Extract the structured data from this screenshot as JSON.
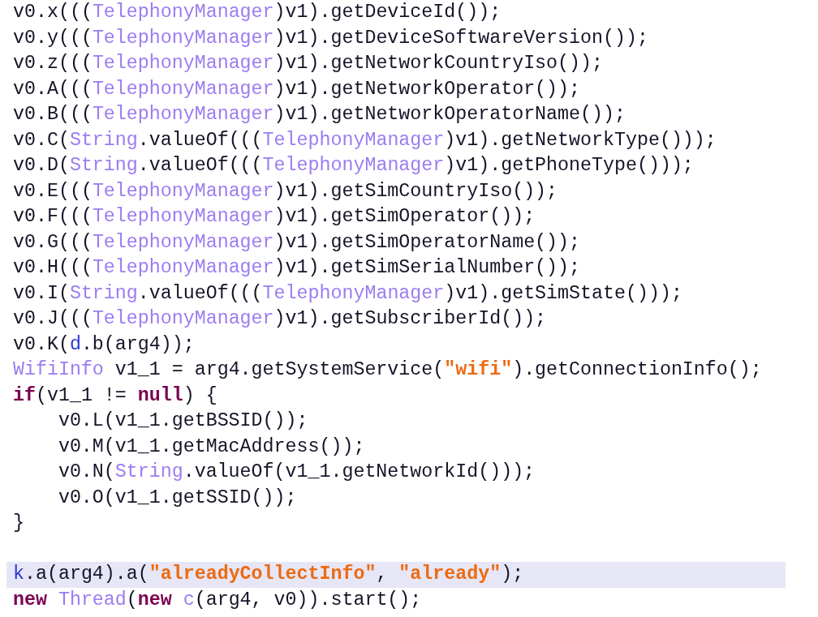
{
  "code_groups": [
    {
      "lines": [
        {
          "selected": false,
          "tokens": [
            {
              "kind": "plain",
              "text": "v0.x((("
            },
            {
              "kind": "type",
              "text": "TelephonyManager"
            },
            {
              "kind": "plain",
              "text": ")v1).getDeviceId());"
            }
          ]
        },
        {
          "selected": false,
          "tokens": [
            {
              "kind": "plain",
              "text": "v0.y((("
            },
            {
              "kind": "type",
              "text": "TelephonyManager"
            },
            {
              "kind": "plain",
              "text": ")v1).getDeviceSoftwareVersion());"
            }
          ]
        },
        {
          "selected": false,
          "tokens": [
            {
              "kind": "plain",
              "text": "v0.z((("
            },
            {
              "kind": "type",
              "text": "TelephonyManager"
            },
            {
              "kind": "plain",
              "text": ")v1).getNetworkCountryIso());"
            }
          ]
        },
        {
          "selected": false,
          "tokens": [
            {
              "kind": "plain",
              "text": "v0.A((("
            },
            {
              "kind": "type",
              "text": "TelephonyManager"
            },
            {
              "kind": "plain",
              "text": ")v1).getNetworkOperator());"
            }
          ]
        },
        {
          "selected": false,
          "tokens": [
            {
              "kind": "plain",
              "text": "v0.B((("
            },
            {
              "kind": "type",
              "text": "TelephonyManager"
            },
            {
              "kind": "plain",
              "text": ")v1).getNetworkOperatorName());"
            }
          ]
        },
        {
          "selected": false,
          "tokens": [
            {
              "kind": "plain",
              "text": "v0.C("
            },
            {
              "kind": "type",
              "text": "String"
            },
            {
              "kind": "plain",
              "text": ".valueOf((("
            },
            {
              "kind": "type",
              "text": "TelephonyManager"
            },
            {
              "kind": "plain",
              "text": ")v1).getNetworkType()));"
            }
          ]
        },
        {
          "selected": false,
          "tokens": [
            {
              "kind": "plain",
              "text": "v0.D("
            },
            {
              "kind": "type",
              "text": "String"
            },
            {
              "kind": "plain",
              "text": ".valueOf((("
            },
            {
              "kind": "type",
              "text": "TelephonyManager"
            },
            {
              "kind": "plain",
              "text": ")v1).getPhoneType()));"
            }
          ]
        },
        {
          "selected": false,
          "tokens": [
            {
              "kind": "plain",
              "text": "v0.E((("
            },
            {
              "kind": "type",
              "text": "TelephonyManager"
            },
            {
              "kind": "plain",
              "text": ")v1).getSimCountryIso());"
            }
          ]
        },
        {
          "selected": false,
          "tokens": [
            {
              "kind": "plain",
              "text": "v0.F((("
            },
            {
              "kind": "type",
              "text": "TelephonyManager"
            },
            {
              "kind": "plain",
              "text": ")v1).getSimOperator());"
            }
          ]
        },
        {
          "selected": false,
          "tokens": [
            {
              "kind": "plain",
              "text": "v0.G((("
            },
            {
              "kind": "type",
              "text": "TelephonyManager"
            },
            {
              "kind": "plain",
              "text": ")v1).getSimOperatorName());"
            }
          ]
        },
        {
          "selected": false,
          "tokens": [
            {
              "kind": "plain",
              "text": "v0.H((("
            },
            {
              "kind": "type",
              "text": "TelephonyManager"
            },
            {
              "kind": "plain",
              "text": ")v1).getSimSerialNumber());"
            }
          ]
        },
        {
          "selected": false,
          "tokens": [
            {
              "kind": "plain",
              "text": "v0.I("
            },
            {
              "kind": "type",
              "text": "String"
            },
            {
              "kind": "plain",
              "text": ".valueOf((("
            },
            {
              "kind": "type",
              "text": "TelephonyManager"
            },
            {
              "kind": "plain",
              "text": ")v1).getSimState()));"
            }
          ]
        },
        {
          "selected": false,
          "tokens": [
            {
              "kind": "plain",
              "text": "v0.J((("
            },
            {
              "kind": "type",
              "text": "TelephonyManager"
            },
            {
              "kind": "plain",
              "text": ")v1).getSubscriberId());"
            }
          ]
        },
        {
          "selected": false,
          "tokens": [
            {
              "kind": "plain",
              "text": "v0.K("
            },
            {
              "kind": "ref",
              "text": "d"
            },
            {
              "kind": "plain",
              "text": ".b(arg4));"
            }
          ]
        },
        {
          "selected": false,
          "tokens": [
            {
              "kind": "type",
              "text": "WifiInfo"
            },
            {
              "kind": "plain",
              "text": " v1_1 = arg4.getSystemService("
            },
            {
              "kind": "string",
              "text": "\"wifi\""
            },
            {
              "kind": "plain",
              "text": ").getConnectionInfo();"
            }
          ]
        },
        {
          "selected": false,
          "tokens": [
            {
              "kind": "keyword",
              "text": "if"
            },
            {
              "kind": "plain",
              "text": "(v1_1 != "
            },
            {
              "kind": "keyword",
              "text": "null"
            },
            {
              "kind": "plain",
              "text": ") {"
            }
          ],
          "children": [
            {
              "selected": false,
              "tokens": [
                {
                  "kind": "plain",
                  "text": "v0.L(v1_1.getBSSID());"
                }
              ]
            },
            {
              "selected": false,
              "tokens": [
                {
                  "kind": "plain",
                  "text": "v0.M(v1_1.getMacAddress());"
                }
              ]
            },
            {
              "selected": false,
              "tokens": [
                {
                  "kind": "plain",
                  "text": "v0.N("
                },
                {
                  "kind": "type",
                  "text": "String"
                },
                {
                  "kind": "plain",
                  "text": ".valueOf(v1_1.getNetworkId()));"
                }
              ]
            },
            {
              "selected": false,
              "tokens": [
                {
                  "kind": "plain",
                  "text": "v0.O(v1_1.getSSID());"
                }
              ]
            }
          ]
        },
        {
          "selected": false,
          "tokens": [
            {
              "kind": "plain",
              "text": "}"
            }
          ]
        }
      ]
    },
    {
      "lines": [
        {
          "selected": true,
          "tokens": [
            {
              "kind": "ref",
              "text": "k"
            },
            {
              "kind": "plain",
              "text": ".a(arg4).a("
            },
            {
              "kind": "string",
              "text": "\"alreadyCollectInfo\""
            },
            {
              "kind": "plain",
              "text": ", "
            },
            {
              "kind": "string",
              "text": "\"already\""
            },
            {
              "kind": "plain",
              "text": ");"
            }
          ]
        },
        {
          "selected": false,
          "tokens": [
            {
              "kind": "keyword",
              "text": "new "
            },
            {
              "kind": "type",
              "text": "Thread"
            },
            {
              "kind": "plain",
              "text": "("
            },
            {
              "kind": "keyword",
              "text": "new "
            },
            {
              "kind": "type",
              "text": "c"
            },
            {
              "kind": "plain",
              "text": "(arg4, v0)).start();"
            }
          ]
        }
      ]
    }
  ]
}
